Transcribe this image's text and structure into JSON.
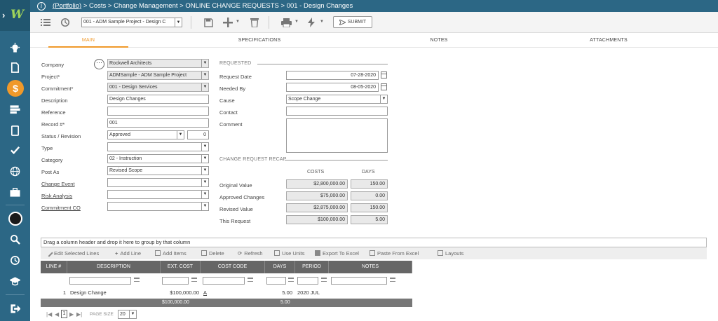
{
  "sidebar": {
    "logo_icon": "chevron-logo",
    "items": [
      {
        "name": "lightbulb-icon"
      },
      {
        "name": "document-icon"
      },
      {
        "name": "dollar-icon",
        "active": true,
        "glyph": "$"
      },
      {
        "name": "list-icon"
      },
      {
        "name": "tablet-icon"
      },
      {
        "name": "check-icon"
      },
      {
        "name": "globe-icon"
      },
      {
        "name": "briefcase-icon"
      },
      {
        "name": "avatar-icon"
      },
      {
        "name": "search-icon"
      },
      {
        "name": "history-icon"
      },
      {
        "name": "graduation-icon"
      },
      {
        "name": "logout-icon"
      }
    ],
    "colors": {
      "bg": "#2c6785",
      "accent": "#f0992a"
    }
  },
  "titlebar": {
    "info_glyph": "i",
    "portfolio": "(Portfolio)",
    "rest": " > Costs > Change Management > ONLINE CHANGE REQUESTS > 001 - Design Changes"
  },
  "toolbar": {
    "record_select": "001 - ADM Sample Project - Design C",
    "submit_label": "SUBMIT"
  },
  "tabs": [
    "MAIN",
    "SPECIFICATIONS",
    "NOTES",
    "ATTACHMENTS"
  ],
  "form": {
    "company": {
      "label": "Company",
      "value": "Rockwell Architects"
    },
    "project": {
      "label": "Project*",
      "value": "ADMSample - ADM Sample Project"
    },
    "commitment": {
      "label": "Commitment*",
      "value": "001 - Design Services"
    },
    "description": {
      "label": "Description",
      "value": "Design Changes"
    },
    "reference": {
      "label": "Reference",
      "value": ""
    },
    "record": {
      "label": "Record #*",
      "value": "001"
    },
    "status": {
      "label": "Status / Revision",
      "value": "Approved",
      "revision": "0"
    },
    "type": {
      "label": "Type",
      "value": ""
    },
    "category": {
      "label": "Category",
      "value": "02 - Instruction"
    },
    "post_as": {
      "label": "Post As",
      "value": "Revised Scope"
    },
    "change_event": {
      "label": "Change Event",
      "value": ""
    },
    "risk_analysis": {
      "label": "Risk Analysis",
      "value": ""
    },
    "commitment_co": {
      "label": "Commitment CO",
      "value": ""
    }
  },
  "requested": {
    "section": "REQUESTED",
    "request_date": {
      "label": "Request Date",
      "value": "07-28-2020"
    },
    "needed_by": {
      "label": "Needed By",
      "value": "08-05-2020"
    },
    "cause": {
      "label": "Cause",
      "value": "Scope Change"
    },
    "contact": {
      "label": "Contact",
      "value": ""
    },
    "comment": {
      "label": "Comment",
      "value": ""
    }
  },
  "recap": {
    "section": "CHANGE REQUEST RECAP",
    "col_costs": "COSTS",
    "col_days": "DAYS",
    "rows": [
      {
        "label": "Original Value",
        "cost": "$2,800,000.00",
        "days": "150.00"
      },
      {
        "label": "Approved Changes",
        "cost": "$75,000.00",
        "days": "0.00"
      },
      {
        "label": "Revised Value",
        "cost": "$2,875,000.00",
        "days": "150.00"
      },
      {
        "label": "This Request",
        "cost": "$100,000.00",
        "days": "5.00"
      }
    ]
  },
  "grid": {
    "group_hint": "Drag a column header and drop it here to group by that column",
    "tools": [
      "Edit Selected Lines",
      "Add Line",
      "Add Items",
      "Delete",
      "Refresh",
      "Use Units",
      "Export To Excel",
      "Paste From Excel",
      "Layouts"
    ],
    "columns": [
      "LINE #",
      "DESCRIPTION",
      "EXT. COST",
      "COST CODE",
      "DAYS",
      "PERIOD",
      "NOTES"
    ],
    "rows": [
      {
        "line": "1",
        "description": "Design Change",
        "ext_cost": "$100,000.00",
        "cost_code": "A",
        "days": "5.00",
        "period": "2020 JUL",
        "notes": ""
      }
    ],
    "totals": {
      "ext_cost": "$100,000.00",
      "days": "5.00"
    },
    "pager": {
      "page": "1",
      "page_size_label": "PAGE SIZE",
      "page_size": "20"
    }
  }
}
